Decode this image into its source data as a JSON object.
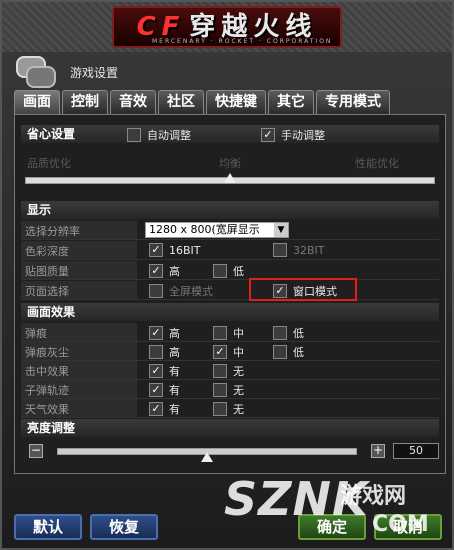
{
  "banner": {
    "logo_mark": "CF",
    "logo_text": "穿越火线",
    "logo_sub": "MERCENARY · ROCKET · CORPORATION"
  },
  "window": {
    "title": "游戏设置"
  },
  "tabs": [
    {
      "label": "画面",
      "active": true
    },
    {
      "label": "控制",
      "active": false
    },
    {
      "label": "音效",
      "active": false
    },
    {
      "label": "社区",
      "active": false
    },
    {
      "label": "快捷键",
      "active": false
    },
    {
      "label": "其它",
      "active": false
    },
    {
      "label": "专用模式",
      "active": false
    }
  ],
  "ease": {
    "heading": "省心设置",
    "auto": {
      "label": "自动调整",
      "checked": false
    },
    "manual": {
      "label": "手动调整",
      "checked": true
    },
    "left_label": "品质优化",
    "mid_label": "均衡",
    "right_label": "性能优化",
    "level": 0.5
  },
  "display": {
    "heading": "显示",
    "resolution": {
      "label": "选择分辨率",
      "value": "1280 x 800(宽屏显示"
    },
    "color_depth": {
      "label": "色彩深度",
      "opt1": "16BIT",
      "opt1_checked": true,
      "opt2": "32BIT",
      "opt2_checked": false
    },
    "texture": {
      "label": "贴图质量",
      "opt1": "高",
      "opt1_checked": true,
      "opt2": "低",
      "opt2_checked": false
    },
    "page_mode": {
      "label": "页面选择",
      "opt1": "全屏模式",
      "opt1_checked": false,
      "opt2": "窗口模式",
      "opt2_checked": true
    }
  },
  "effects": {
    "heading": "画面效果",
    "rows": [
      {
        "label": "弹痕",
        "opts": [
          {
            "t": "高",
            "c": true
          },
          {
            "t": "中",
            "c": false
          },
          {
            "t": "低",
            "c": false
          }
        ]
      },
      {
        "label": "弹痕灰尘",
        "opts": [
          {
            "t": "高",
            "c": false
          },
          {
            "t": "中",
            "c": true
          },
          {
            "t": "低",
            "c": false
          }
        ]
      },
      {
        "label": "击中效果",
        "opts": [
          {
            "t": "有",
            "c": true
          },
          {
            "t": "无",
            "c": false
          }
        ]
      },
      {
        "label": "子弹轨迹",
        "opts": [
          {
            "t": "有",
            "c": true
          },
          {
            "t": "无",
            "c": false
          }
        ]
      },
      {
        "label": "天气效果",
        "opts": [
          {
            "t": "有",
            "c": true
          },
          {
            "t": "无",
            "c": false
          }
        ]
      }
    ]
  },
  "brightness": {
    "heading": "亮度调整",
    "minus": "−",
    "plus": "+",
    "value": "50",
    "level": 0.5
  },
  "buttons": {
    "default": "默认",
    "restore": "恢复",
    "ok": "确定",
    "cancel": "取消"
  },
  "watermark": {
    "text1": "SZNK",
    "text2": "游戏网",
    "text3": "COM"
  },
  "colors": {
    "highlight": "#e0201e",
    "accent_blue": "#2f4f8a"
  }
}
